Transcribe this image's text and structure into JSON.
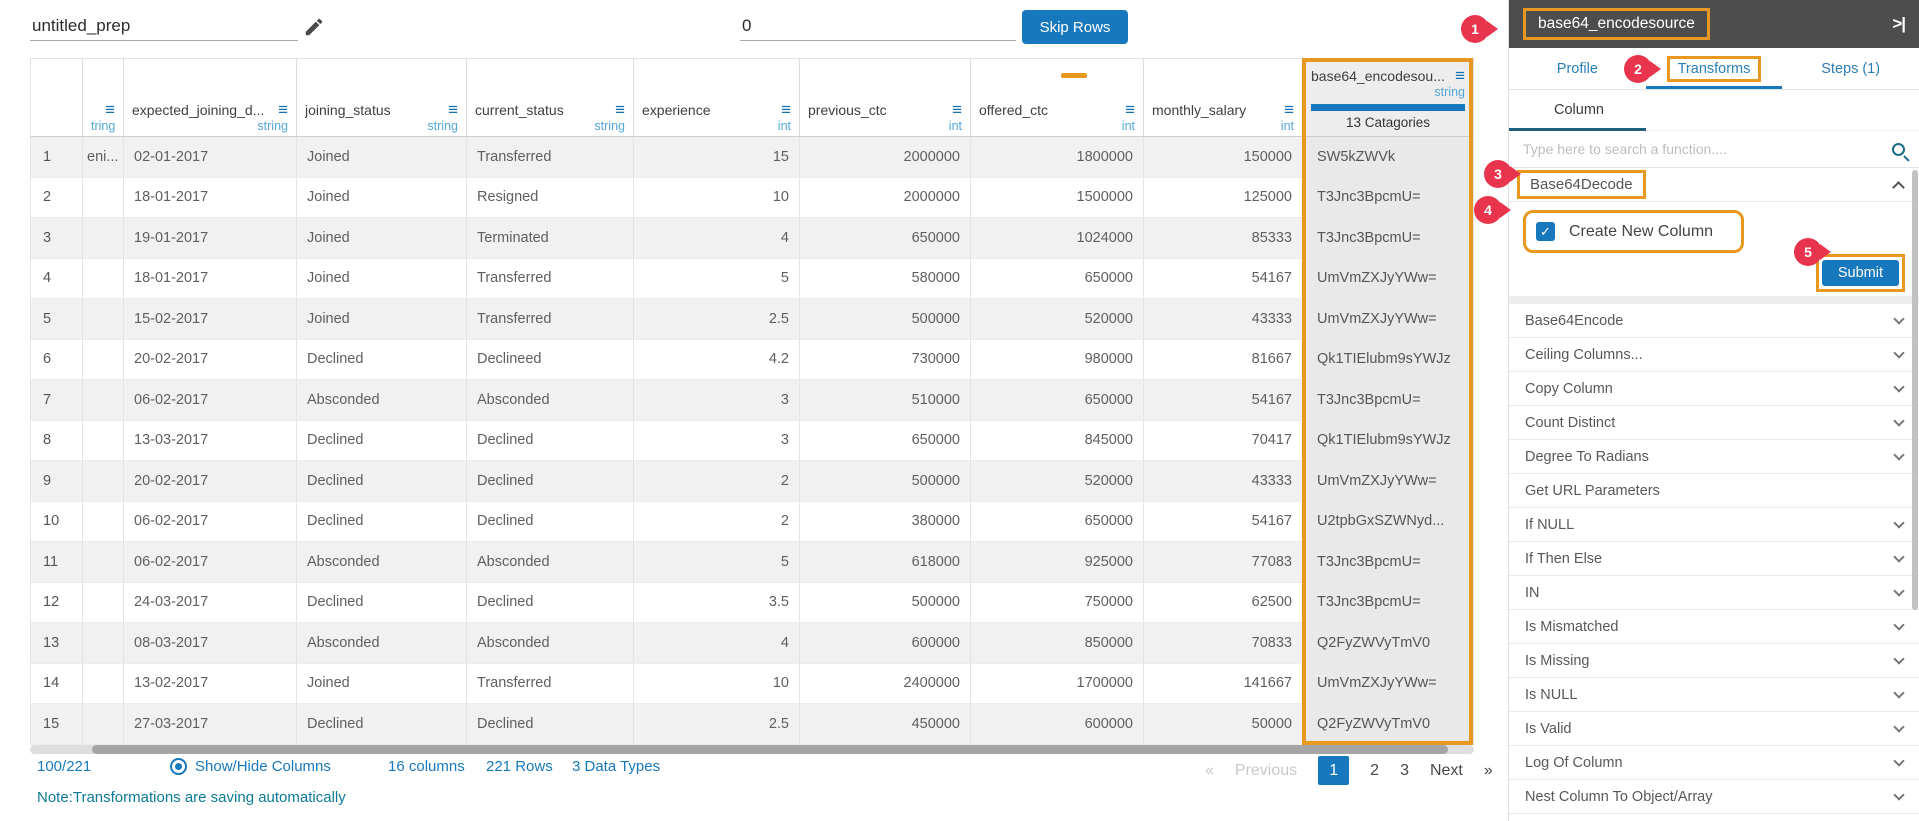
{
  "colors": {
    "primary_blue": "#1778be",
    "annotation_orange": "#e8981e",
    "badge_red": "#e8354d",
    "panel_header_gray": "#4d4d4d",
    "note_teal": "#0d7a93",
    "type_label_blue": "#54a7d8"
  },
  "topbar": {
    "prep_name": "untitled_prep",
    "skip_rows_value": "0",
    "skip_rows_button": "Skip Rows"
  },
  "table": {
    "columns": [
      {
        "label": "",
        "type": "",
        "menu": false
      },
      {
        "label": "",
        "type": "tring",
        "menu": true
      },
      {
        "label": "expected_joining_d...",
        "type": "string",
        "menu": true
      },
      {
        "label": "joining_status",
        "type": "string",
        "menu": true
      },
      {
        "label": "current_status",
        "type": "string",
        "menu": true
      },
      {
        "label": "experience",
        "type": "int",
        "menu": true
      },
      {
        "label": "previous_ctc",
        "type": "int",
        "menu": true
      },
      {
        "label": "offered_ctc",
        "type": "int",
        "menu": true,
        "marker": true
      },
      {
        "label": "monthly_salary",
        "type": "int",
        "menu": true
      },
      {
        "label": "base64_encodesou...",
        "type": "string",
        "menu": true,
        "categories": "13 Catagories"
      }
    ],
    "rows": [
      {
        "n": "1",
        "cells": [
          "eni...",
          "02-01-2017",
          "Joined",
          "Transferred",
          "15",
          "2000000",
          "1800000",
          "150000",
          "SW5kZWVk"
        ]
      },
      {
        "n": "2",
        "cells": [
          "",
          "18-01-2017",
          "Joined",
          "Resigned",
          "10",
          "2000000",
          "1500000",
          "125000",
          "T3Jnc3BpcmU="
        ]
      },
      {
        "n": "3",
        "cells": [
          "",
          "19-01-2017",
          "Joined",
          "Terminated",
          "4",
          "650000",
          "1024000",
          "85333",
          "T3Jnc3BpcmU="
        ]
      },
      {
        "n": "4",
        "cells": [
          "",
          "18-01-2017",
          "Joined",
          "Transferred",
          "5",
          "580000",
          "650000",
          "54167",
          "UmVmZXJyYWw="
        ]
      },
      {
        "n": "5",
        "cells": [
          "",
          "15-02-2017",
          "Joined",
          "Transferred",
          "2.5",
          "500000",
          "520000",
          "43333",
          "UmVmZXJyYWw="
        ]
      },
      {
        "n": "6",
        "cells": [
          "",
          "20-02-2017",
          "Declined",
          "Declineed",
          "4.2",
          "730000",
          "980000",
          "81667",
          "Qk1TIElubm9sYWJz"
        ]
      },
      {
        "n": "7",
        "cells": [
          "",
          "06-02-2017",
          "Absconded",
          "Absconded",
          "3",
          "510000",
          "650000",
          "54167",
          "T3Jnc3BpcmU="
        ]
      },
      {
        "n": "8",
        "cells": [
          "",
          "13-03-2017",
          "Declined",
          "Declined",
          "3",
          "650000",
          "845000",
          "70417",
          "Qk1TIElubm9sYWJz"
        ]
      },
      {
        "n": "9",
        "cells": [
          "",
          "20-02-2017",
          "Declined",
          "Declined",
          "2",
          "500000",
          "520000",
          "43333",
          "UmVmZXJyYWw="
        ]
      },
      {
        "n": "10",
        "cells": [
          "",
          "06-02-2017",
          "Declined",
          "Declined",
          "2",
          "380000",
          "650000",
          "54167",
          "U2tpbGxSZWNyd..."
        ]
      },
      {
        "n": "11",
        "cells": [
          "",
          "06-02-2017",
          "Absconded",
          "Absconded",
          "5",
          "618000",
          "925000",
          "77083",
          "T3Jnc3BpcmU="
        ]
      },
      {
        "n": "12",
        "cells": [
          "",
          "24-03-2017",
          "Declined",
          "Declined",
          "3.5",
          "500000",
          "750000",
          "62500",
          "T3Jnc3BpcmU="
        ]
      },
      {
        "n": "13",
        "cells": [
          "",
          "08-03-2017",
          "Absconded",
          "Absconded",
          "4",
          "600000",
          "850000",
          "70833",
          "Q2FyZWVyTmV0"
        ]
      },
      {
        "n": "14",
        "cells": [
          "",
          "13-02-2017",
          "Joined",
          "Transferred",
          "10",
          "2400000",
          "1700000",
          "141667",
          "UmVmZXJyYWw="
        ]
      },
      {
        "n": "15",
        "cells": [
          "",
          "27-03-2017",
          "Declined",
          "Declined",
          "2.5",
          "450000",
          "600000",
          "50000",
          "Q2FyZWVyTmV0"
        ]
      }
    ]
  },
  "footer": {
    "count": "100/221",
    "show_hide": "Show/Hide Columns",
    "columns_count": "16 columns",
    "rows_count": "221 Rows",
    "data_types": "3 Data Types",
    "note": "Note:Transformations are saving automatically",
    "pagination": {
      "prev_arrow": "«",
      "prev": "Previous",
      "pages": [
        {
          "label": "1",
          "active": true
        },
        {
          "label": "2",
          "active": false
        },
        {
          "label": "3",
          "active": false
        }
      ],
      "next": "Next",
      "next_arrow": "»"
    }
  },
  "panel": {
    "title": "base64_encodesource",
    "collapse_icon": ">|",
    "tabs": [
      {
        "label": "Profile",
        "active": false
      },
      {
        "label": "Transforms",
        "active": true
      },
      {
        "label": "Steps (1)",
        "active": false
      }
    ],
    "subtab": "Column",
    "search_placeholder": "Type here to search a function....",
    "expanded": {
      "name": "Base64Decode",
      "checkbox_label": "Create New Column",
      "checked": true,
      "submit": "Submit"
    },
    "functions": [
      {
        "label": "Base64Encode",
        "chevron": true
      },
      {
        "label": "Ceiling Columns...",
        "chevron": true
      },
      {
        "label": "Copy Column",
        "chevron": true
      },
      {
        "label": "Count Distinct",
        "chevron": true
      },
      {
        "label": "Degree To Radians",
        "chevron": true
      },
      {
        "label": "Get URL Parameters",
        "chevron": false
      },
      {
        "label": "If NULL",
        "chevron": true
      },
      {
        "label": "If Then Else",
        "chevron": true
      },
      {
        "label": "IN",
        "chevron": true
      },
      {
        "label": "Is Mismatched",
        "chevron": true
      },
      {
        "label": "Is Missing",
        "chevron": true
      },
      {
        "label": "Is NULL",
        "chevron": true
      },
      {
        "label": "Is Valid",
        "chevron": true
      },
      {
        "label": "Log Of Column",
        "chevron": true
      },
      {
        "label": "Nest Column To Object/Array",
        "chevron": true
      }
    ]
  },
  "annotations": {
    "badges": [
      "1",
      "2",
      "3",
      "4",
      "5"
    ]
  }
}
